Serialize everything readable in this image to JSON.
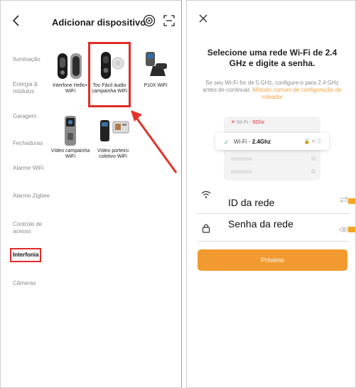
{
  "left": {
    "header": {
      "title": "Adicionar dispositivo"
    },
    "categories": [
      {
        "label": "Iluminação"
      },
      {
        "label": "Energia & módulos"
      },
      {
        "label": "Garagem"
      },
      {
        "label": "Fechaduras"
      },
      {
        "label": "Alarme WiFi"
      },
      {
        "label": "Alarme Zigbee"
      },
      {
        "label": "Controle de acesso"
      },
      {
        "label": "Interfonia",
        "active": true
      },
      {
        "label": "Câmeras"
      }
    ],
    "devices": [
      {
        "label": "Interfone Hello+ WiFi"
      },
      {
        "label": "Toc Fácil áudio campainha WiFi",
        "highlighted": true
      },
      {
        "label": "P10X WiFi"
      },
      {
        "label": "Vídeo campainha WiFi"
      },
      {
        "label": "Vídeo porteiro coletivo WiFi"
      }
    ],
    "highlight_color": "#e02d27"
  },
  "right": {
    "title": "Selecione uma rede Wi-Fi de 2.4 GHz e digite a senha.",
    "subtitle_text": "Se seu Wi-Fi for de 5 GHz, configure-o para 2.4 GHz antes de continuar.",
    "subtitle_link": "Método comum de configuração de roteador",
    "wifi_5g_prefix": "Wi-Fi - ",
    "wifi_5g_band": "5Ghz",
    "wifi_24_prefix": "Wi-Fi - ",
    "wifi_24_band": "2.4Ghz",
    "network_id_label": "ID da rede",
    "password_label": "Senha da rede",
    "next_button": "Próximo",
    "accent_color": "#f29a2f"
  }
}
